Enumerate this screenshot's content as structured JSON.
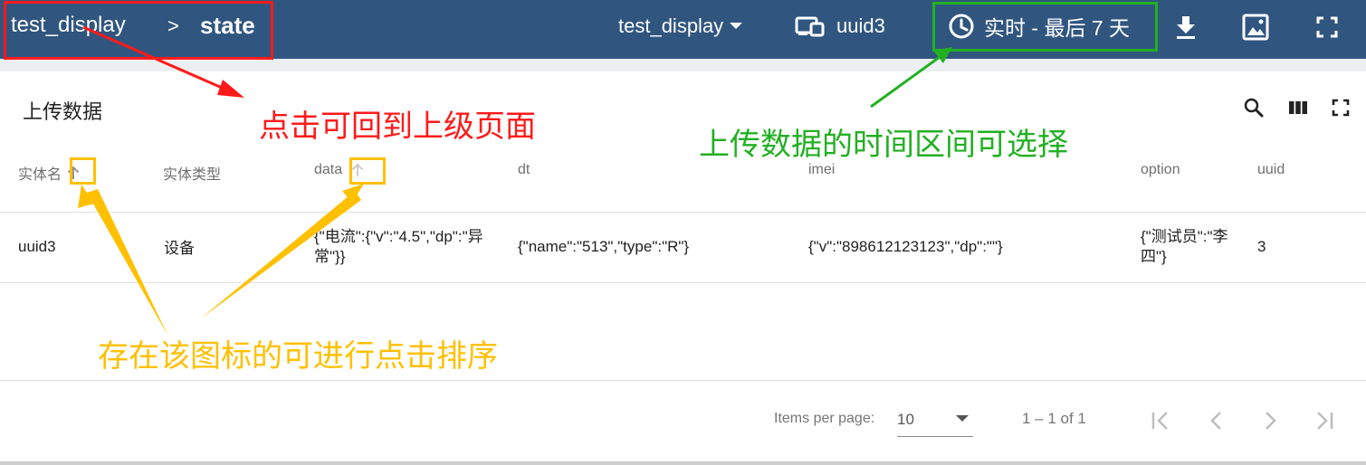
{
  "header": {
    "breadcrumb_root": "test_display",
    "breadcrumb_separator": ">",
    "breadcrumb_current": "state",
    "dashboard_select": "test_display",
    "device_label": "uuid3",
    "time_window": "实时 - 最后 7 天",
    "icons": [
      "chevron-down-icon",
      "device-icon",
      "clock-icon",
      "download-icon",
      "image-icon",
      "fullscreen-icon"
    ]
  },
  "card": {
    "title": "上传数据",
    "tool_icons": [
      "search-icon",
      "columns-icon",
      "fullscreen-icon"
    ]
  },
  "table": {
    "columns": [
      "实体名",
      "实体类型",
      "data",
      "dt",
      "imei",
      "option",
      "uuid"
    ],
    "rows": [
      {
        "entity_name": "uuid3",
        "entity_type": "设备",
        "data_line1": "{\"电流\":{\"v\":\"4.5\",\"dp\":\"异",
        "data_line2": "常\"}}",
        "dt": "{\"name\":\"513\",\"type\":\"R\"}",
        "imei": "{\"v\":\"898612123123\",\"dp\":\"\"}",
        "option_line1": "{\"测试员\":\"李",
        "option_line2": "四\"}",
        "uuid": "3"
      }
    ]
  },
  "pagination": {
    "items_per_page_label": "Items per page:",
    "items_per_page_value": "10",
    "range": "1 – 1 of 1"
  },
  "annotations": {
    "breadcrumb_note": "点击可回到上级页面",
    "time_note": "上传数据的时间区间可选择",
    "sort_note": "存在该图标的可进行点击排序",
    "colors": {
      "red": "#ff1a1a",
      "green": "#22b022",
      "orange": "#ffc000"
    }
  }
}
